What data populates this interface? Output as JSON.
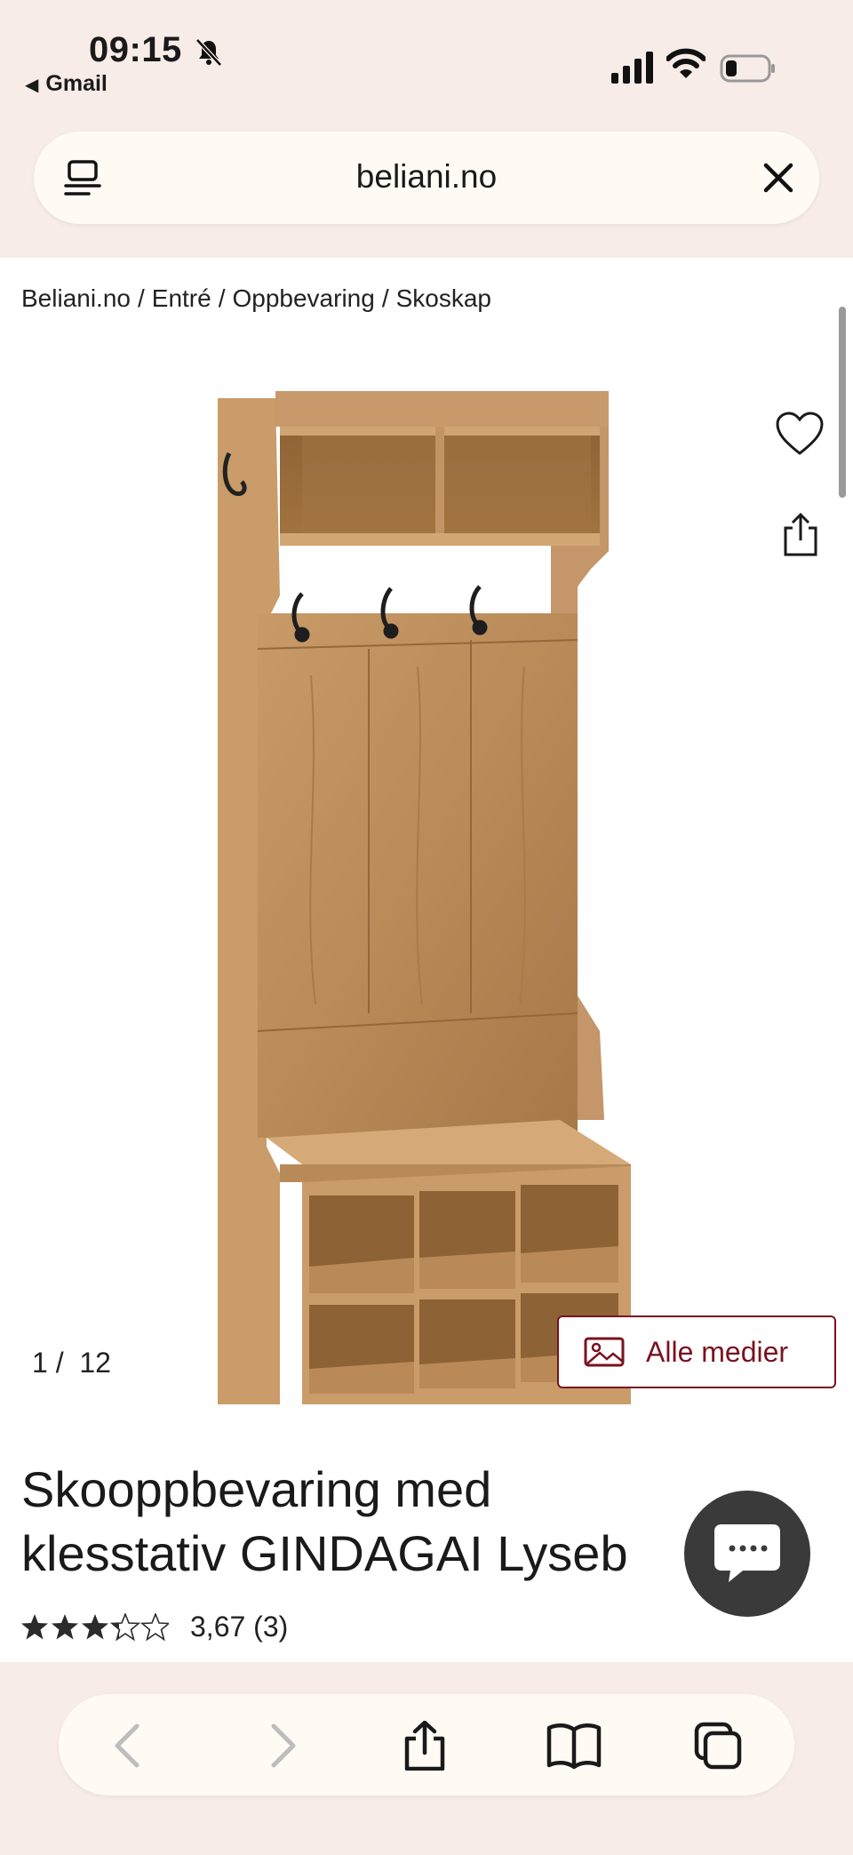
{
  "status_bar": {
    "time": "09:15",
    "back_app": "Gmail"
  },
  "browser": {
    "url": "beliani.no"
  },
  "breadcrumb": [
    "Beliani.no",
    "Entré",
    "Oppbevaring",
    "Skoskap"
  ],
  "gallery": {
    "current": "1",
    "total": "12",
    "all_media_label": "Alle medier"
  },
  "product": {
    "title_line1": "Skooppbevaring med",
    "title_line2": "klesstativ GINDAGAI Lyseb",
    "rating_value": 3.67,
    "rating_text": "3,67",
    "review_count": "(3)"
  },
  "icons": {
    "wishlist": "heart-icon",
    "share": "share-icon",
    "chat": "chat-icon",
    "tabs": "tabs-icon",
    "close": "close-icon"
  },
  "colors": {
    "chrome_background": "#f8ece8",
    "accent": "#7a1220",
    "chat_button": "#3a3a3a"
  }
}
